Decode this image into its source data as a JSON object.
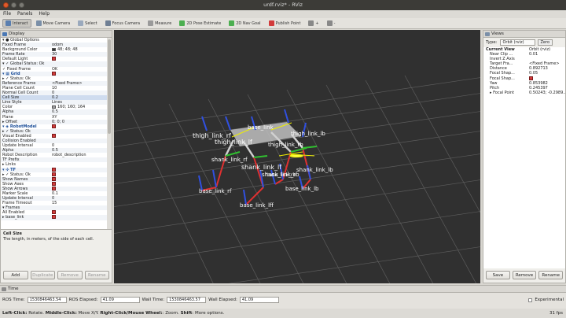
{
  "window": {
    "title": "urdf.rviz* - RViz"
  },
  "menu": [
    "File",
    "Panels",
    "Help"
  ],
  "toolbar": [
    {
      "label": "Interact",
      "icon": "interact-icon",
      "color": "#5a7fb0",
      "active": true
    },
    {
      "label": "Move Camera",
      "icon": "move-camera-icon",
      "color": "#7a8fa8"
    },
    {
      "label": "Select",
      "icon": "select-icon",
      "color": "#9aa9bd"
    },
    {
      "label": "Focus Camera",
      "icon": "focus-camera-icon",
      "color": "#6f7f94"
    },
    {
      "label": "Measure",
      "icon": "measure-icon",
      "color": "#9a9a9a"
    },
    {
      "label": "2D Pose Estimate",
      "icon": "pose-estimate-icon",
      "color": "#4caf50"
    },
    {
      "label": "2D Nav Goal",
      "icon": "nav-goal-icon",
      "color": "#4caf50"
    },
    {
      "label": "Publish Point",
      "icon": "publish-point-icon",
      "color": "#d23b3b"
    },
    {
      "label": "+",
      "icon": "add-tool-icon",
      "color": "#888"
    },
    {
      "label": "-",
      "icon": "remove-tool-icon",
      "color": "#888"
    }
  ],
  "display": {
    "title": "Display",
    "rows": [
      {
        "k": "▾ ● Global Options",
        "v": "",
        "hdr": false
      },
      {
        "k": "    Fixed Frame",
        "v": "odom"
      },
      {
        "k": "    Background Color",
        "v": "48; 48; 48",
        "swatch": "#303030"
      },
      {
        "k": "    Frame Rate",
        "v": "30"
      },
      {
        "k": "    Default Light",
        "v": "",
        "chk": true
      },
      {
        "k": "▾ ✓ Global Status: Ok",
        "v": ""
      },
      {
        "k": "    ✓ Fixed Frame",
        "v": "OK"
      },
      {
        "k": "▾ ▦ Grid",
        "v": "",
        "chk": true,
        "hdr": true
      },
      {
        "k": "  ▸ ✓ Status: Ok",
        "v": ""
      },
      {
        "k": "    Reference Frame",
        "v": "<Fixed Frame>"
      },
      {
        "k": "    Plane Cell Count",
        "v": "10"
      },
      {
        "k": "    Normal Cell Count",
        "v": "0"
      },
      {
        "k": "    Cell Size",
        "v": "0.2",
        "sel": true
      },
      {
        "k": "    Line Style",
        "v": "Lines"
      },
      {
        "k": "    Color",
        "v": "160; 160; 164",
        "swatch": "#a0a0a4"
      },
      {
        "k": "    Alpha",
        "v": "0.5"
      },
      {
        "k": "    Plane",
        "v": "XY"
      },
      {
        "k": "  ▸ Offset",
        "v": "0; 0; 0"
      },
      {
        "k": "▾ ◈ RobotModel",
        "v": "",
        "chk": true,
        "hdr": true
      },
      {
        "k": "  ▸ ✓ Status: Ok",
        "v": ""
      },
      {
        "k": "    Visual Enabled",
        "v": "",
        "chk": true
      },
      {
        "k": "    Collision Enabled",
        "v": ""
      },
      {
        "k": "    Update Interval",
        "v": "0"
      },
      {
        "k": "    Alpha",
        "v": "0.5"
      },
      {
        "k": "    Robot Description",
        "v": "robot_description"
      },
      {
        "k": "    TF Prefix",
        "v": ""
      },
      {
        "k": "  ▸ Links",
        "v": ""
      },
      {
        "k": "▾ ✣ TF",
        "v": "",
        "chk": true,
        "hdr": true
      },
      {
        "k": "  ▸ ✓ Status: Ok",
        "v": "",
        "chk": true
      },
      {
        "k": "    Show Names",
        "v": "",
        "chk": true
      },
      {
        "k": "    Show Axes",
        "v": "",
        "chk": true
      },
      {
        "k": "    Show Arrows",
        "v": "",
        "chk": true
      },
      {
        "k": "    Marker Scale",
        "v": "0.1"
      },
      {
        "k": "    Update Interval",
        "v": "0"
      },
      {
        "k": "    Frame Timeout",
        "v": "15"
      },
      {
        "k": "  ▾ Frames",
        "v": ""
      },
      {
        "k": "      All Enabled",
        "v": "",
        "chk": true
      },
      {
        "k": "    ▸ base_link",
        "v": "",
        "chk": true
      }
    ],
    "help_title": "Cell Size",
    "help_text": "The length, in meters, of the side of each cell.",
    "buttons": [
      "Add",
      "Duplicate",
      "Remove",
      "Rename"
    ]
  },
  "views": {
    "title": "Views",
    "type_label": "Type:",
    "type_value": "Orbit (rviz)",
    "zero": "Zero",
    "rows": [
      {
        "k": "Current View",
        "v": "Orbit (rviz)",
        "hdr": true
      },
      {
        "k": "Near Clip ...",
        "v": "0.01"
      },
      {
        "k": "Invert Z Axis",
        "v": ""
      },
      {
        "k": "Target Fra...",
        "v": "<Fixed Frame>"
      },
      {
        "k": "Distance",
        "v": "0.892713"
      },
      {
        "k": "Focal Shap...",
        "v": "0.05"
      },
      {
        "k": "Focal Shap...",
        "v": "",
        "chk": true
      },
      {
        "k": "Yaw",
        "v": "0.853982"
      },
      {
        "k": "Pitch",
        "v": "0.245397"
      },
      {
        "k": "▸ Focal Point",
        "v": "0.50243; -0.2989..."
      }
    ],
    "buttons": [
      "Save",
      "Remove",
      "Rename"
    ]
  },
  "scene": {
    "labels": [
      "thigh_link_rf",
      "thigh_link_lf",
      "base_link",
      "thigh_link_rb",
      "thigh_link_lb",
      "shank_link_rf",
      "shank_link_lf",
      "shank_link_rb",
      "shank_link_lb",
      "base_link_rf",
      "base_link_rb",
      "base_link_lb",
      "base_link_lff"
    ]
  },
  "time": {
    "title": "Time",
    "ros_time_label": "ROS Time:",
    "ros_time": "1530846463.54",
    "ros_elapsed_label": "ROS Elapsed:",
    "ros_elapsed": "41.09",
    "wall_time_label": "Wall Time:",
    "wall_time": "1530846463.57",
    "wall_elapsed_label": "Wall Elapsed:",
    "wall_elapsed": "41.09",
    "experimental": "Experimental"
  },
  "status": {
    "text_bold1": "Left-Click:",
    "text1": " Rotate. ",
    "text_bold2": "Middle-Click:",
    "text2": " Move X/Y. ",
    "text_bold3": "Right-Click/Mouse Wheel:",
    "text3": ": Zoom. ",
    "text_bold4": "Shift",
    "text4": ": More options.",
    "fps": "31 fps"
  }
}
